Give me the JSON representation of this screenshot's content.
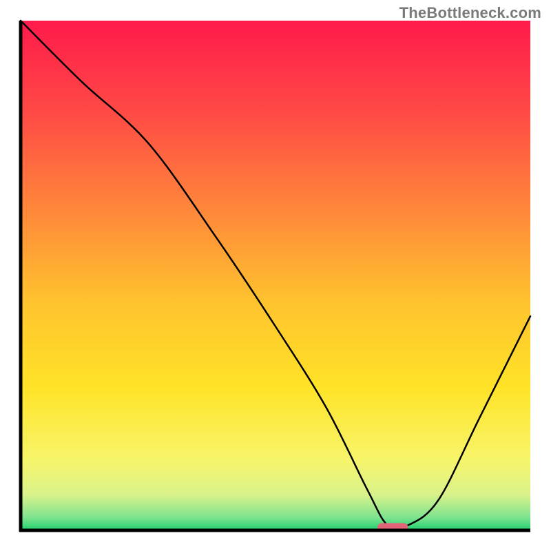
{
  "watermark": "TheBottleneck.com",
  "chart_data": {
    "type": "line",
    "title": "",
    "xlabel": "",
    "ylabel": "",
    "xlim": [
      0,
      100
    ],
    "ylim": [
      0,
      100
    ],
    "grid": false,
    "legend": false,
    "series": [
      {
        "name": "bottleneck-curve",
        "x": [
          0,
          12,
          25,
          38,
          50,
          60,
          68,
          72,
          76,
          82,
          90,
          100
        ],
        "y": [
          100,
          88,
          76,
          58,
          40,
          24,
          8,
          1,
          1,
          6,
          22,
          42
        ]
      }
    ],
    "optimum_marker": {
      "x_start": 70,
      "x_end": 76,
      "y": 0.6
    },
    "gradient_stops": [
      {
        "offset": 0.0,
        "color": "#ff1a4b"
      },
      {
        "offset": 0.18,
        "color": "#ff4a45"
      },
      {
        "offset": 0.38,
        "color": "#ff8a3a"
      },
      {
        "offset": 0.55,
        "color": "#ffc22e"
      },
      {
        "offset": 0.72,
        "color": "#ffe327"
      },
      {
        "offset": 0.86,
        "color": "#f7f56a"
      },
      {
        "offset": 0.93,
        "color": "#d9f28a"
      },
      {
        "offset": 0.975,
        "color": "#7de38f"
      },
      {
        "offset": 1.0,
        "color": "#20d070"
      }
    ]
  }
}
